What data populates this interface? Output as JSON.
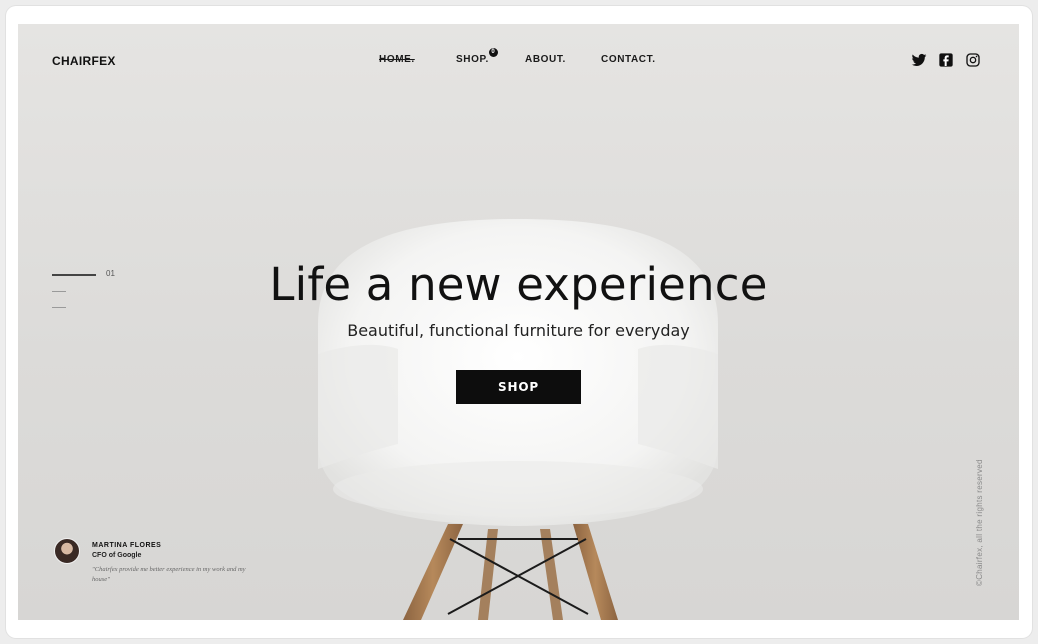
{
  "brand": {
    "logo": "CHAIRFEX"
  },
  "nav": {
    "items": [
      {
        "label": "HOME.",
        "active": true
      },
      {
        "label": "SHOP.",
        "badge": "0"
      },
      {
        "label": "ABOUT."
      },
      {
        "label": "CONTACT."
      }
    ]
  },
  "socials": [
    "twitter-icon",
    "facebook-icon",
    "instagram-icon"
  ],
  "slider": {
    "current": "01",
    "total_lines": 3
  },
  "hero": {
    "headline": "Life a new experience",
    "subheadline": "Beautiful, functional furniture for everyday",
    "cta_label": "SHOP"
  },
  "testimonial": {
    "name": "MARTINA FLORES",
    "role": "CFO of Google",
    "quote": "\"Chairfex provide me better experience in my work and my house\""
  },
  "footer": {
    "copyright": "©Chairfex, all the rights reserved"
  },
  "colors": {
    "background": "#dedddb",
    "accent": "#0d0d0d",
    "chair": "#f7f7f6",
    "wood": "#a67a4f"
  }
}
